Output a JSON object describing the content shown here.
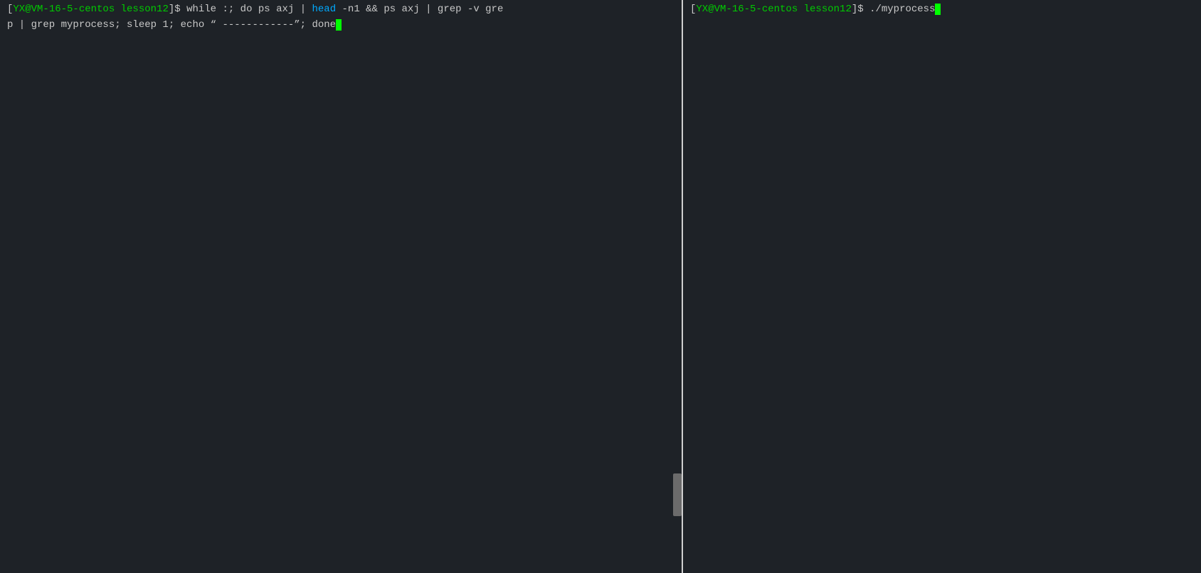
{
  "left_pane": {
    "line1": "[YX@VM-16-5-centos lesson12]$ while :; do ps axj | head -n1 && ps axj | grep -v gre",
    "line2": "p | grep myprocess; sleep 1; echo “ ------------”; done",
    "cursor_after_line2": true
  },
  "right_pane": {
    "line1": "[YX@VM-16-5-centos lesson12]$ ./myprocess",
    "cursor_after_line1": true
  },
  "colors": {
    "background": "#1e2227",
    "text": "#c8c8c8",
    "prompt_green": "#00cc00",
    "cursor_green": "#00ff00",
    "divider": "#d0d0d0",
    "scrollbar": "#6b6b6b"
  }
}
